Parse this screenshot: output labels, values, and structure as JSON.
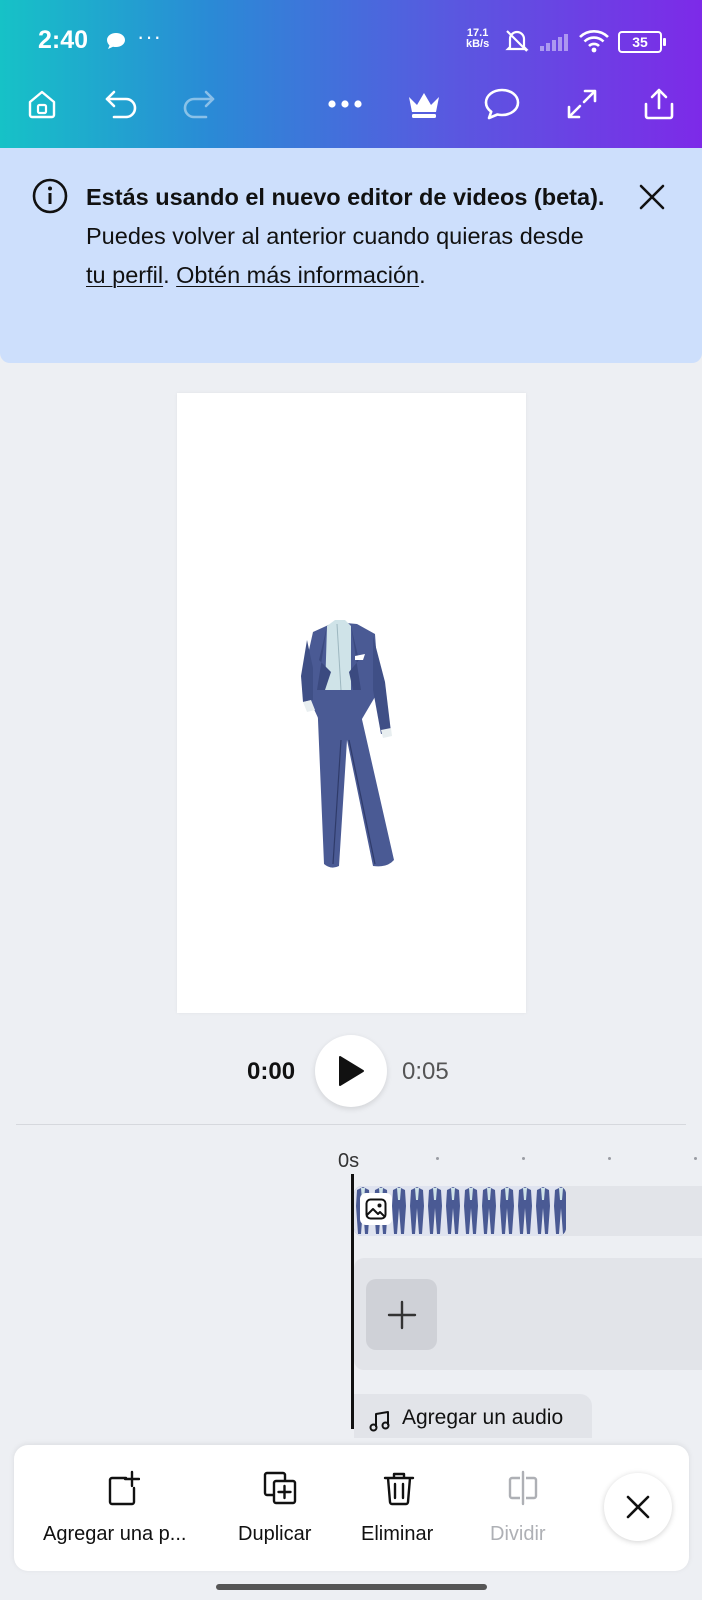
{
  "status_bar": {
    "time": "2:40",
    "dots": "···",
    "net_speed_value": "17.1",
    "net_speed_unit": "kB/s",
    "battery": "35"
  },
  "toolbar": {
    "icons": [
      "home-icon",
      "undo-icon",
      "redo-icon",
      "more-icon",
      "crown-icon",
      "comment-icon",
      "expand-icon",
      "share-icon"
    ]
  },
  "banner": {
    "bold_text": "Estás usando el nuevo editor de videos (beta).",
    "text_1": " Puedes volver al anterior cuando quieras desde ",
    "link_profile": "tu perfil",
    "text_2": ". ",
    "link_more": "Obtén más información",
    "text_end": "."
  },
  "playback": {
    "current_time": "0:00",
    "total_time": "0:05"
  },
  "timeline": {
    "start_label": "0s",
    "audio_label": "Agregar un audio"
  },
  "bottom_bar": {
    "add_page": "Agregar una p...",
    "duplicate": "Duplicar",
    "delete": "Eliminar",
    "split": "Dividir"
  },
  "colors": {
    "accent_gradient_start": "#16c2c7",
    "accent_gradient_end": "#7d2ae8",
    "banner_bg": "#cddffc",
    "suit_blue": "#4a5a94"
  }
}
